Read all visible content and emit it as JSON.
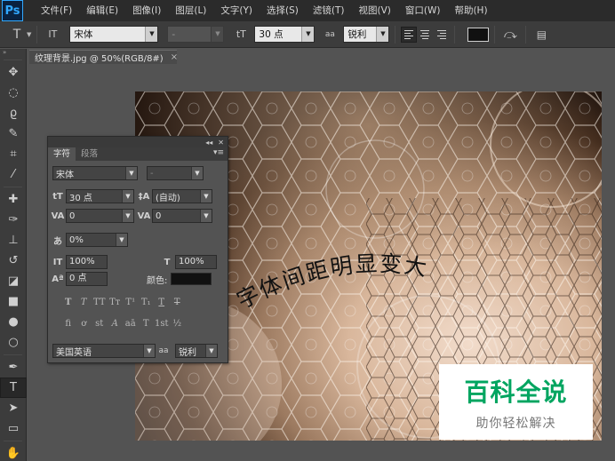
{
  "app": {
    "logo": "Ps"
  },
  "menu": [
    "文件(F)",
    "编辑(E)",
    "图像(I)",
    "图层(L)",
    "文字(Y)",
    "选择(S)",
    "滤镜(T)",
    "视图(V)",
    "窗口(W)",
    "帮助(H)"
  ],
  "options": {
    "tool_icon": "T",
    "orientation_icon": "IT",
    "font_family": "宋体",
    "font_style": "-",
    "size_icon": "tT",
    "font_size": "30 点",
    "aa_icon": "aa",
    "antialias": "锐利",
    "text_color": "#111111"
  },
  "document_tab": {
    "title": "纹理背景.jpg @ 50%(RGB/8#)",
    "close": "×"
  },
  "char_panel": {
    "tab_character": "字符",
    "tab_paragraph": "段落",
    "font_family": "宋体",
    "font_style": "-",
    "font_size": "30 点",
    "leading": "(自动)",
    "kerning": "0",
    "tracking": "0",
    "baseline_scale": "0%",
    "vertical_scale": "100%",
    "horizontal_scale": "100%",
    "baseline_shift": "0 点",
    "color_label": "颜色:",
    "color": "#111111",
    "style_row1": [
      "T",
      "T",
      "TT",
      "Tт",
      "T¹",
      "T₁",
      "T",
      "T"
    ],
    "style_row2": [
      "fi",
      "ơ",
      "st",
      "A",
      "aā",
      "T",
      "1st",
      "½"
    ],
    "language": "美国英语",
    "aa_label": "aa",
    "antialias": "锐利"
  },
  "canvas": {
    "curved_text": "字体间距明显变大"
  },
  "watermark": {
    "title": "百科全说",
    "subtitle": "助你轻松解决"
  }
}
